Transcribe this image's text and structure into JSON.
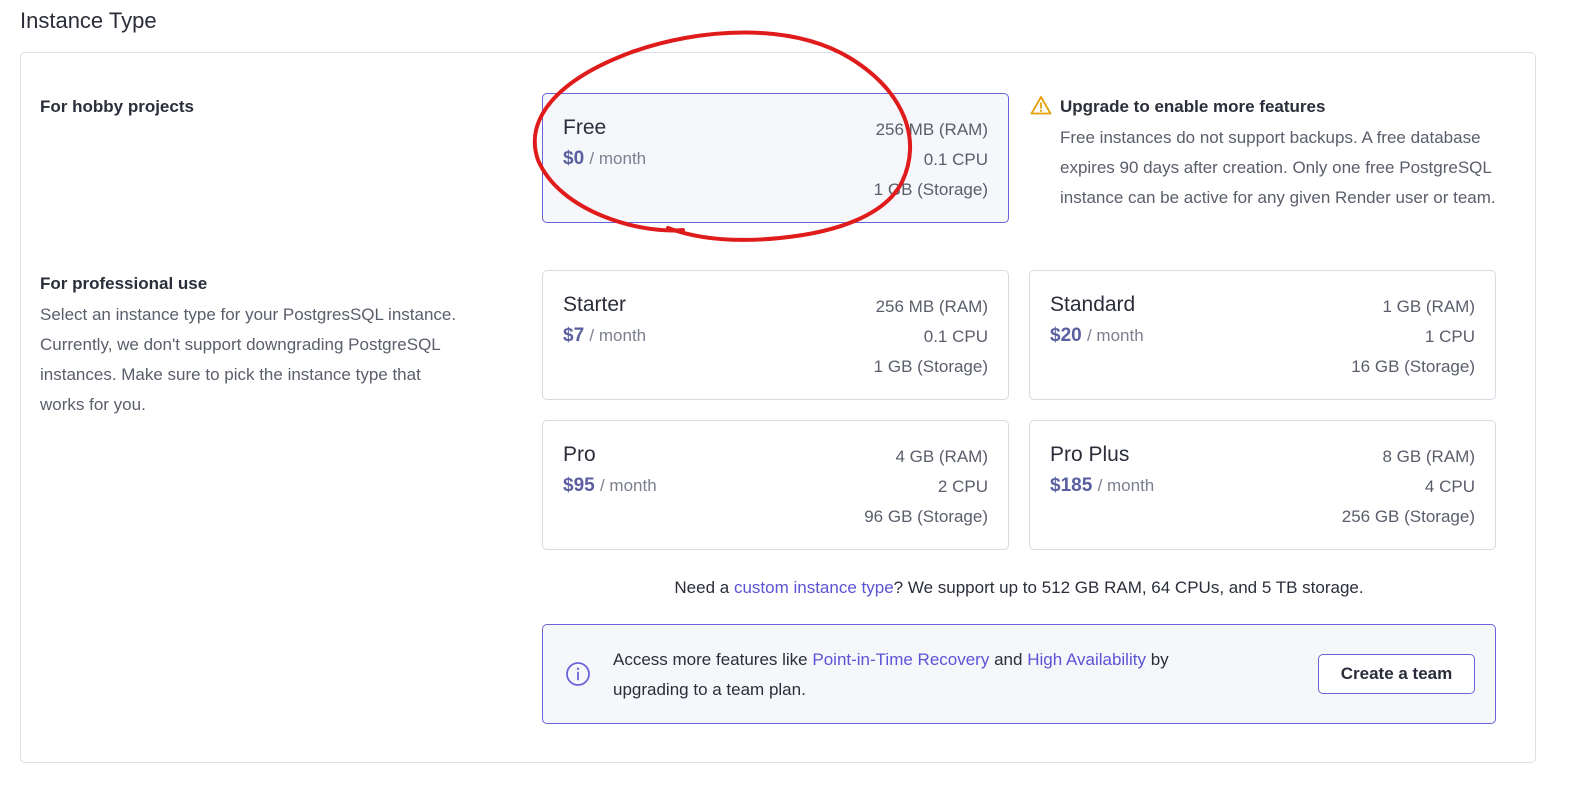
{
  "section_title": "Instance Type",
  "hobby": {
    "heading": "For hobby projects"
  },
  "professional": {
    "heading": "For professional use",
    "description": "Select an instance type for your PostgresSQL instance. Currently, we don't support downgrading PostgreSQL instances. Make sure to pick the instance type that works for you."
  },
  "plans": {
    "free": {
      "name": "Free",
      "price": "$0",
      "period": "/ month",
      "ram": "256 MB (RAM)",
      "cpu": "0.1 CPU",
      "storage": "1 GB (Storage)",
      "selected": true
    },
    "starter": {
      "name": "Starter",
      "price": "$7",
      "period": "/ month",
      "ram": "256 MB (RAM)",
      "cpu": "0.1 CPU",
      "storage": "1 GB (Storage)"
    },
    "standard": {
      "name": "Standard",
      "price": "$20",
      "period": "/ month",
      "ram": "1 GB (RAM)",
      "cpu": "1 CPU",
      "storage": "16 GB (Storage)"
    },
    "pro": {
      "name": "Pro",
      "price": "$95",
      "period": "/ month",
      "ram": "4 GB (RAM)",
      "cpu": "2 CPU",
      "storage": "96 GB (Storage)"
    },
    "pro_plus": {
      "name": "Pro Plus",
      "price": "$185",
      "period": "/ month",
      "ram": "8 GB (RAM)",
      "cpu": "4 CPU",
      "storage": "256 GB (Storage)"
    }
  },
  "warning": {
    "icon": "warning-triangle-icon",
    "title": "Upgrade to enable more features",
    "body": "Free instances do not support backups. A free database expires 90 days after creation. Only one free PostgreSQL instance can be active for any given Render user or team."
  },
  "custom": {
    "prefix": "Need a",
    "link": "custom instance type",
    "suffix": "? We support up to 512 GB RAM, 64 CPUs, and 5 TB storage."
  },
  "info": {
    "icon": "info-circle-icon",
    "text_1": "Access more features like",
    "link_1": "Point-in-Time Recovery",
    "text_2": "and",
    "link_2": "High Availability",
    "text_3": "by upgrading to a team plan.",
    "button": "Create a team"
  },
  "colors": {
    "accent": "#6a63d8",
    "link": "#5b54d6",
    "warning": "#e3a008",
    "annotation": "#e01b1b"
  }
}
